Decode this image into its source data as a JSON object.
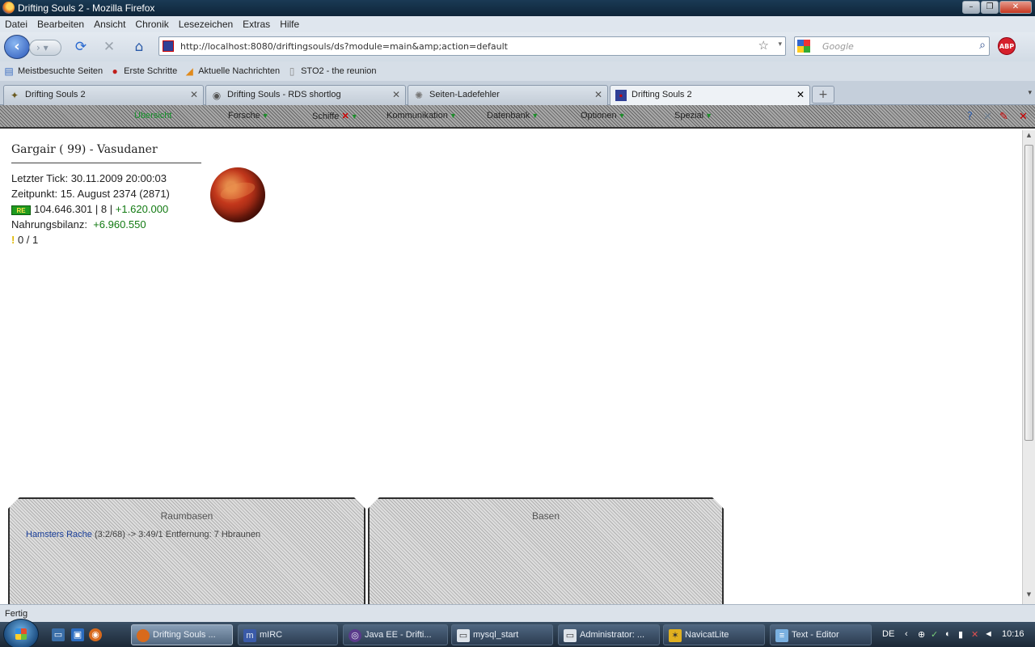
{
  "window": {
    "title": "Drifting Souls 2 - Mozilla Firefox"
  },
  "menubar": {
    "items": [
      "Datei",
      "Bearbeiten",
      "Ansicht",
      "Chronik",
      "Lesezeichen",
      "Extras",
      "Hilfe"
    ]
  },
  "navbar": {
    "url": "http://localhost:8080/driftingsouls/ds?module=main&amp;action=default",
    "search_placeholder": "Google",
    "abp_label": "ABP"
  },
  "bookmarks": {
    "items": [
      "Meistbesuchte Seiten",
      "Erste Schritte",
      "Aktuelle Nachrichten",
      "STO2 - the reunion"
    ]
  },
  "tabs": {
    "items": [
      {
        "label": "Drifting Souls 2",
        "active": false
      },
      {
        "label": "Drifting Souls - RDS shortlog",
        "active": false
      },
      {
        "label": "Seiten-Ladefehler",
        "active": false
      },
      {
        "label": "Drifting Souls 2",
        "active": true
      }
    ],
    "new_tab": "+"
  },
  "gamemenu": {
    "items": [
      "Übersicht",
      "Forsche",
      "Schiffe",
      "Kommunikation",
      "Datenbank",
      "Optionen",
      "Spezial"
    ]
  },
  "base": {
    "title": "Gargair ( 99) - Vasudaner",
    "last_tick_label": "Letzter Tick:",
    "last_tick_value": "30.11.2009 20:00:03",
    "time_label": "Zeitpunkt:",
    "time_value": "15. August 2374 (2871)",
    "re_icon": "RE",
    "re_value": "104.646.301 | 8 |",
    "re_delta": "+1.620.000",
    "food_label": "Nahrungsbilanz:",
    "food_value": "+6.960.550",
    "officers": "0 / 1"
  },
  "panels": {
    "left": {
      "title": "Raumbasen",
      "row_link": "Hamsters Rache",
      "row_text": "(3:2/68) -> 3:49/1 Entfernung: 7 Hbraunen"
    },
    "right": {
      "title": "Basen"
    }
  },
  "statusbar": {
    "text": "Fertig"
  },
  "taskbar": {
    "tasks": [
      "Drifting Souls ...",
      "mIRC",
      "Java EE - Drifti...",
      "mysql_start",
      "Administrator: ...",
      "NavicatLite",
      "Text - Editor"
    ],
    "tray_lang": "DE",
    "tray_time": "10:16"
  }
}
